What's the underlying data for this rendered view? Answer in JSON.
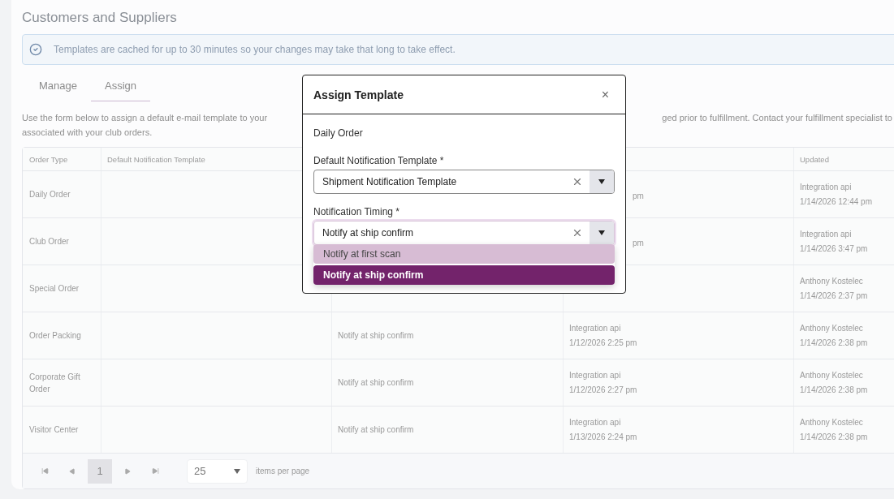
{
  "page": {
    "title": "Customers and Suppliers"
  },
  "notice": {
    "text": "Templates are cached for up to 30 minutes so your changes may take that long to take effect."
  },
  "tabs": [
    {
      "label": "Manage",
      "selected": false
    },
    {
      "label": "Assign",
      "selected": true
    }
  ],
  "intro": {
    "line_1_start": "Use the form below to assign a default e-mail template to your",
    "line_1_end": "ged prior to fulfillment. Contact your fulfillment specialist to",
    "line_2": "associated with your club orders."
  },
  "table": {
    "columns": [
      {
        "label": "Order Type"
      },
      {
        "label": "Default Notification Template"
      },
      {},
      {},
      {
        "label": "Updated"
      }
    ],
    "rows": [
      {
        "order_type": "Daily Order",
        "column_4_partial": "pm",
        "updated": [
          "Integration api",
          "1/14/2026 12:44 pm"
        ]
      },
      {
        "order_type": "Club Order",
        "column_4_partial": "pm",
        "updated": [
          "Integration api",
          "1/14/2026 3:47 pm"
        ]
      },
      {
        "order_type": "Special Order",
        "updated": [
          "Anthony Kostelec",
          "1/14/2026 2:37 pm"
        ]
      },
      {
        "order_type": "Order Packing",
        "column_3": "Notify at ship confirm",
        "column_4": [
          "Integration api",
          "1/12/2026 2:25 pm"
        ],
        "updated": [
          "Anthony Kostelec",
          "1/14/2026 2:38 pm"
        ]
      },
      {
        "order_type": "Corporate Gift Order",
        "column_3": "Notify at ship confirm",
        "column_4": [
          "Integration api",
          "1/12/2026 2:27 pm"
        ],
        "updated": [
          "Anthony Kostelec",
          "1/14/2026 2:38 pm"
        ]
      },
      {
        "order_type": "Visitor Center",
        "column_3": "Notify at ship confirm",
        "column_4": [
          "Integration api",
          "1/13/2026 2:24 pm"
        ],
        "updated": [
          "Anthony Kostelec",
          "1/14/2026 2:38 pm"
        ]
      }
    ]
  },
  "pagination": {
    "page": "1",
    "page_size": "25",
    "page_size_label": "items per page"
  },
  "modal": {
    "title": "Assign Template",
    "close": "×",
    "order_type": "Daily Order",
    "fields": [
      {
        "label": "Default Notification Template *",
        "value": "Shipment Notification Template",
        "open": false
      },
      {
        "label": "Notification Timing *",
        "value": "Notify at ship confirm",
        "open": true,
        "options": [
          {
            "label": "Notify at first scan",
            "selected": false
          },
          {
            "label": "Notify at ship confirm",
            "selected": true
          }
        ]
      }
    ]
  }
}
